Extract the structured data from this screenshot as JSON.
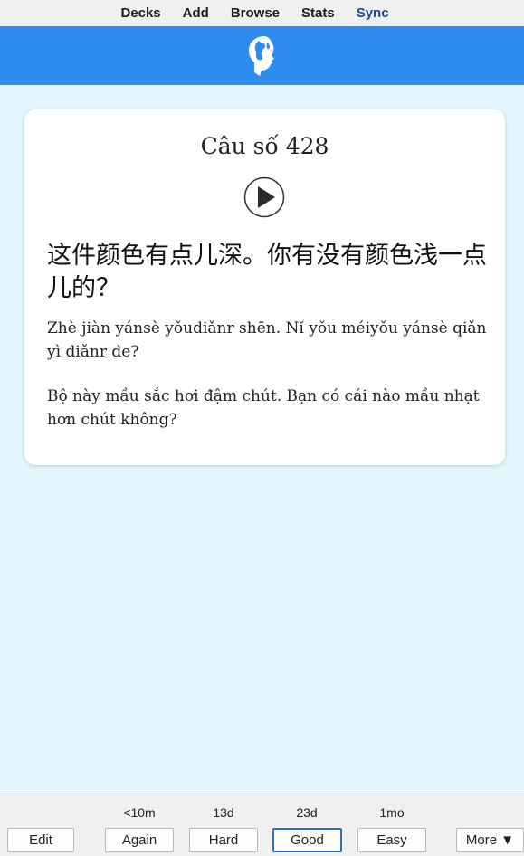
{
  "nav": {
    "items": [
      "Decks",
      "Add",
      "Browse",
      "Stats",
      "Sync"
    ]
  },
  "banner": {
    "logo_icon": "anki-globe-head-logo",
    "color": "#2d8cf0"
  },
  "card": {
    "title": "Câu số 428",
    "audio_icon": "play-icon",
    "chinese": "这件颜色有点儿深。你有没有颜色浅一点儿的？",
    "pinyin": "Zhè jiàn yánsè yǒudiǎnr shēn. Nǐ yǒu méiyǒu yánsè qiǎn yì diǎnr de?",
    "vietnamese": "Bộ này mầu sắc hơi đậm chút. Bạn có cái nào mầu nhạt hơn chút không?"
  },
  "review": {
    "intervals": [
      "<10m",
      "13d",
      "23d",
      "1mo"
    ],
    "edit_label": "Edit",
    "again_label": "Again",
    "hard_label": "Hard",
    "good_label": "Good",
    "easy_label": "Easy",
    "more_label": "More ▼"
  },
  "colors": {
    "background": "#e4f6fd",
    "accent": "#2d8cf0",
    "sync_text": "#1a4ba0"
  }
}
